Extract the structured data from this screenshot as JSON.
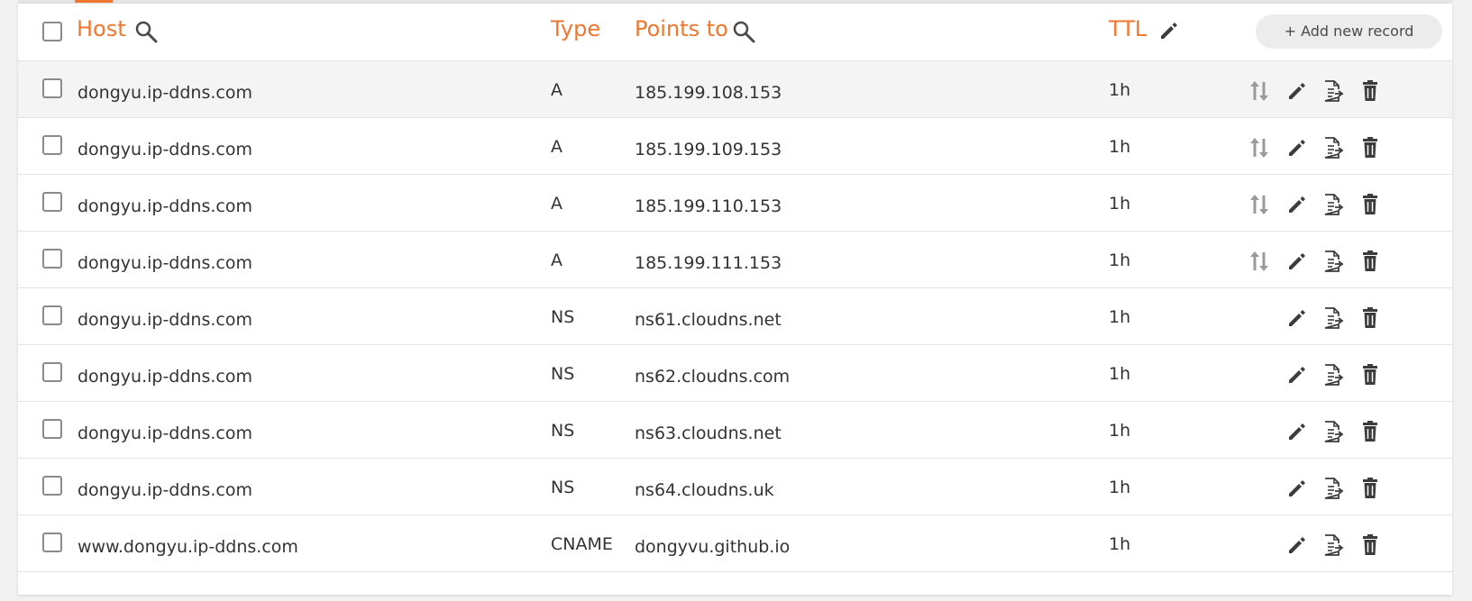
{
  "header": {
    "host_label": "Host",
    "type_label": "Type",
    "points_to_label": "Points to",
    "ttl_label": "TTL",
    "add_button_label": "+ Add new record"
  },
  "colors": {
    "accent": "#f0772e",
    "text": "#333333",
    "icon": "#3c3c3c",
    "icon_muted": "#9a9a9a"
  },
  "records": [
    {
      "host": "dongyu.ip-ddns.com",
      "type": "A",
      "points_to": "185.199.108.153",
      "ttl": "1h",
      "actions": [
        "move-icon",
        "edit-icon",
        "copy-icon",
        "delete-icon"
      ]
    },
    {
      "host": "dongyu.ip-ddns.com",
      "type": "A",
      "points_to": "185.199.109.153",
      "ttl": "1h",
      "actions": [
        "move-icon",
        "edit-icon",
        "copy-icon",
        "delete-icon"
      ]
    },
    {
      "host": "dongyu.ip-ddns.com",
      "type": "A",
      "points_to": "185.199.110.153",
      "ttl": "1h",
      "actions": [
        "move-icon",
        "edit-icon",
        "copy-icon",
        "delete-icon"
      ]
    },
    {
      "host": "dongyu.ip-ddns.com",
      "type": "A",
      "points_to": "185.199.111.153",
      "ttl": "1h",
      "actions": [
        "move-icon",
        "edit-icon",
        "copy-icon",
        "delete-icon"
      ]
    },
    {
      "host": "dongyu.ip-ddns.com",
      "type": "NS",
      "points_to": "ns61.cloudns.net",
      "ttl": "1h",
      "actions": [
        "edit-icon",
        "copy-icon",
        "delete-icon"
      ]
    },
    {
      "host": "dongyu.ip-ddns.com",
      "type": "NS",
      "points_to": "ns62.cloudns.com",
      "ttl": "1h",
      "actions": [
        "edit-icon",
        "copy-icon",
        "delete-icon"
      ]
    },
    {
      "host": "dongyu.ip-ddns.com",
      "type": "NS",
      "points_to": "ns63.cloudns.net",
      "ttl": "1h",
      "actions": [
        "edit-icon",
        "copy-icon",
        "delete-icon"
      ]
    },
    {
      "host": "dongyu.ip-ddns.com",
      "type": "NS",
      "points_to": "ns64.cloudns.uk",
      "ttl": "1h",
      "actions": [
        "edit-icon",
        "copy-icon",
        "delete-icon"
      ]
    },
    {
      "host": "www.dongyu.ip-ddns.com",
      "type": "CNAME",
      "points_to": "dongyvu.github.io",
      "ttl": "1h",
      "actions": [
        "edit-icon",
        "copy-icon",
        "delete-icon"
      ]
    }
  ]
}
